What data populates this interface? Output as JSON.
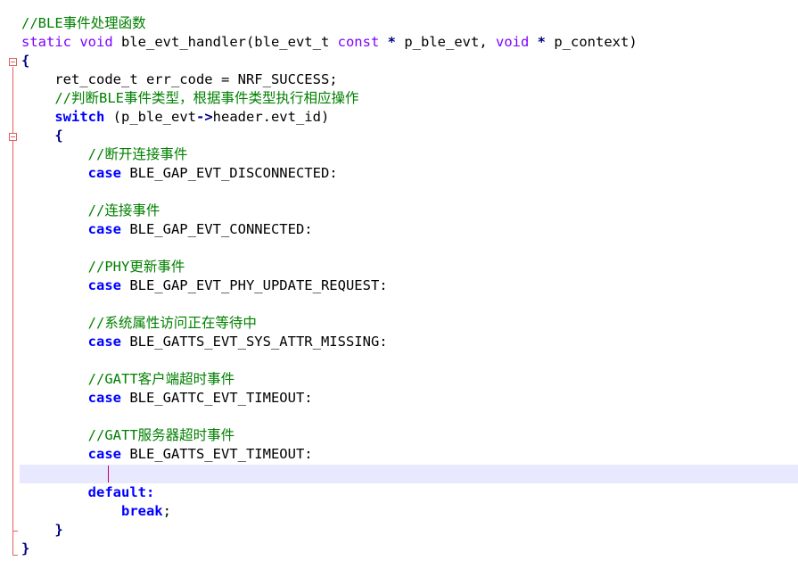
{
  "colors": {
    "comment": "#008000",
    "type_keyword": "#8000ff",
    "control_keyword": "#0000ff",
    "operator": "#000080",
    "fold_marker": "#e06060",
    "current_line": "#e8e8ff",
    "caret": "#c00070"
  },
  "code": {
    "l1_comment": "//BLE事件处理函数",
    "l2_static": "static",
    "l2_void": "void",
    "l2_name": " ble_evt_handler(ble_evt_t ",
    "l2_const": "const",
    "l2_star1": "*",
    "l2_param1": " p_ble_evt, ",
    "l2_void2": "void",
    "l2_star2": "*",
    "l2_param2": " p_context)",
    "l3_brace": "{",
    "l4_text": "    ret_code_t err_code = NRF_SUCCESS;",
    "l5_comment": "    //判断BLE事件类型，根据事件类型执行相应操作",
    "l6_switch": "switch",
    "l6_paren": " (p_ble_evt",
    "l6_arrow": "->",
    "l6_rest": "header.evt_id)",
    "l7_brace": "{",
    "l8_comment": "//断开连接事件",
    "l9_case": "case",
    "l9_label": " BLE_GAP_EVT_DISCONNECTED:",
    "l11_comment": "//连接事件",
    "l12_case": "case",
    "l12_label": " BLE_GAP_EVT_CONNECTED:",
    "l14_comment": "//PHY更新事件",
    "l15_case": "case",
    "l15_label": " BLE_GAP_EVT_PHY_UPDATE_REQUEST:",
    "l17_comment": "//系统属性访问正在等待中",
    "l18_case": "case",
    "l18_label": " BLE_GATTS_EVT_SYS_ATTR_MISSING:",
    "l20_comment": "//GATT客户端超时事件",
    "l21_case": "case",
    "l21_label": " BLE_GATTC_EVT_TIMEOUT:",
    "l23_comment": "//GATT服务器超时事件",
    "l24_case": "case",
    "l24_label": " BLE_GATTS_EVT_TIMEOUT:",
    "l26_default": "default:",
    "l27_break": "break",
    "l27_semi": ";",
    "l28_brace": "}",
    "l29_brace": "}"
  }
}
